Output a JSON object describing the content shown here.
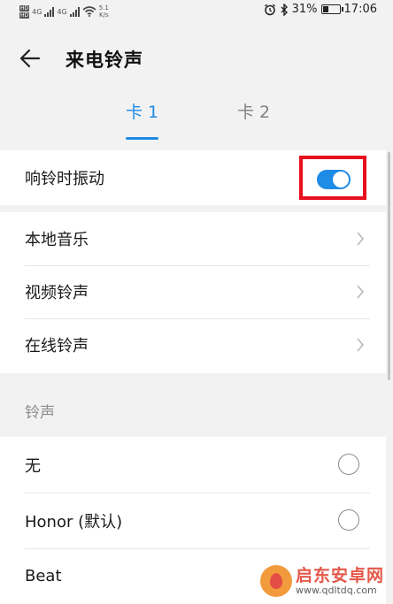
{
  "status_bar": {
    "hd_1": "HD",
    "hd_2": "HD",
    "signal_1": "4G",
    "signal_2": "4G",
    "net_speed_value": "5.1",
    "net_speed_unit": "K/s",
    "battery_percent": "31%",
    "battery_level": 0.31,
    "time": "17:06",
    "icons": [
      "alarm-icon",
      "bluetooth-icon",
      "battery-icon",
      "wifi-icon",
      "signal-icon"
    ]
  },
  "header": {
    "title": "来电铃声",
    "back_icon": "arrow-left-icon"
  },
  "tabs": [
    {
      "label": "卡 1",
      "active": true
    },
    {
      "label": "卡 2",
      "active": false
    }
  ],
  "vibrate": {
    "label": "响铃时振动",
    "enabled": true
  },
  "sources": [
    {
      "label": "本地音乐"
    },
    {
      "label": "视频铃声"
    },
    {
      "label": "在线铃声"
    }
  ],
  "ringtone_section": {
    "label": "铃声",
    "items": [
      {
        "label": "无",
        "selected": false
      },
      {
        "label": "Honor (默认)",
        "selected": false
      },
      {
        "label": "Beat",
        "selected": false
      }
    ]
  },
  "watermark": {
    "name": "启东安卓网",
    "url": "www.qdltdq.com"
  },
  "colors": {
    "accent": "#1e8be6",
    "highlight": "#e8101d",
    "background": "#f2f2f2"
  }
}
